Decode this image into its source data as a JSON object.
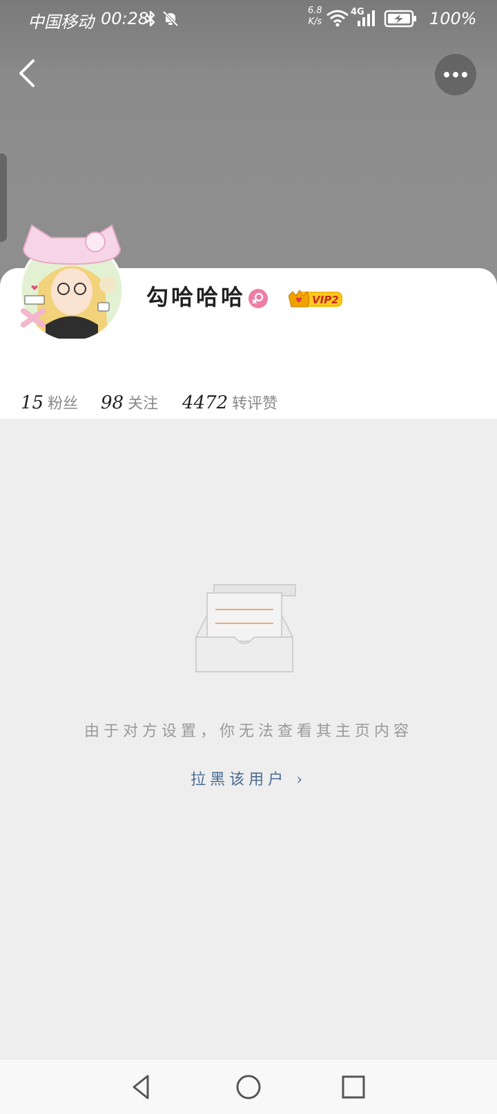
{
  "status_bar": {
    "carrier": "中国移动",
    "time": "00:28",
    "net_speed_value": "6.8",
    "net_speed_unit": "K/s",
    "network": "4G",
    "battery": "100%"
  },
  "profile": {
    "username": "勾哈哈哈",
    "vip_label": "VIP2",
    "gender": "female",
    "stats": [
      {
        "value": "15",
        "label": "粉丝"
      },
      {
        "value": "98",
        "label": "关注"
      },
      {
        "value": "4472",
        "label": "转评赞"
      }
    ]
  },
  "empty_state": {
    "message": "由于对方设置，你无法查看其主页内容",
    "block_link": "拉黑该用户 ›"
  },
  "colors": {
    "header_gray": "#8c8c8c",
    "gender_pink": "#f07ca4",
    "vip_gold": "#f5b800",
    "link_blue": "#4a6a92"
  }
}
